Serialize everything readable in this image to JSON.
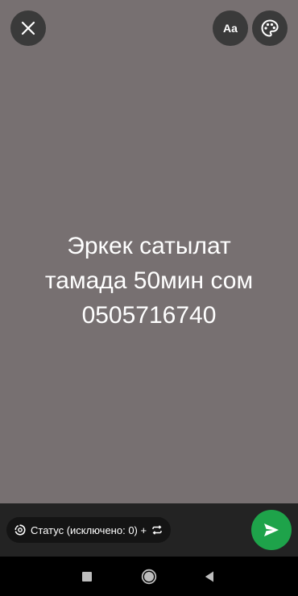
{
  "status": {
    "lines": [
      "Эркек сатылат",
      "тамада 50мин сом",
      "0505716740"
    ],
    "background_color": "#777071",
    "text_color": "#ffffff"
  },
  "toolbar": {
    "close_icon": "close-icon",
    "font_label": "Aa",
    "palette_icon": "palette-icon"
  },
  "footer": {
    "audience_label": "Статус (исключено: 0) +",
    "audience_icon": "status-ring-icon",
    "repeat_icon": "repeat-icon",
    "send_icon": "send-icon",
    "send_color": "#1ea34a"
  },
  "navigation": {
    "recent_icon": "recent-apps-icon",
    "home_icon": "home-icon",
    "back_icon": "back-icon"
  }
}
